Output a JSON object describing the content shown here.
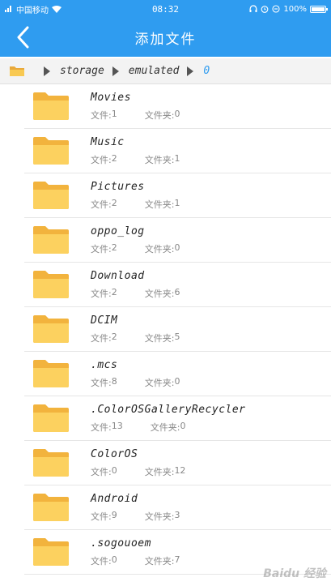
{
  "status_bar": {
    "carrier": "中国移动",
    "time": "08:32",
    "battery": "100%"
  },
  "header": {
    "title": "添加文件"
  },
  "breadcrumb": {
    "segments": [
      "storage",
      "emulated",
      "0"
    ]
  },
  "labels": {
    "files": "文件:",
    "folders": "文件夹:"
  },
  "files": [
    {
      "name": "Movies",
      "files": "1",
      "folders": "0"
    },
    {
      "name": "Music",
      "files": "2",
      "folders": "1"
    },
    {
      "name": "Pictures",
      "files": "2",
      "folders": "1"
    },
    {
      "name": "oppo_log",
      "files": "2",
      "folders": "0"
    },
    {
      "name": "Download",
      "files": "2",
      "folders": "6"
    },
    {
      "name": "DCIM",
      "files": "2",
      "folders": "5"
    },
    {
      "name": ".mcs",
      "files": "8",
      "folders": "0"
    },
    {
      "name": ".ColorOSGalleryRecycler",
      "files": "13",
      "folders": "0"
    },
    {
      "name": "ColorOS",
      "files": "0",
      "folders": "12"
    },
    {
      "name": "Android",
      "files": "9",
      "folders": "3"
    },
    {
      "name": ".sogouoem",
      "files": "0",
      "folders": "7"
    }
  ],
  "watermark": "Baidu 经验",
  "colors": {
    "accent": "#2f9cf0",
    "folder": "#f7bc45",
    "folder_front": "#fcd05e"
  }
}
